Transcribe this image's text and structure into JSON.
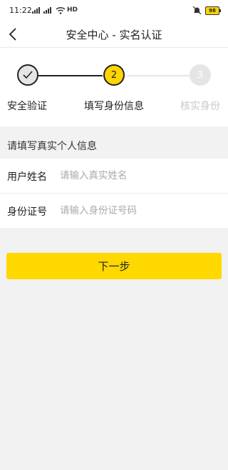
{
  "status_bar": {
    "time": "11:22",
    "network": "HD",
    "battery": "98"
  },
  "header": {
    "title": "安全中心 - 实名认证"
  },
  "steps": [
    {
      "number": "",
      "label": "安全验证",
      "state": "done"
    },
    {
      "number": "2",
      "label": "填写身份信息",
      "state": "active"
    },
    {
      "number": "3",
      "label": "核实身份",
      "state": "pending"
    }
  ],
  "form": {
    "hint": "请填写真实个人信息",
    "name": {
      "label": "用户姓名",
      "value": "",
      "placeholder": "请输入真实姓名"
    },
    "id_number": {
      "label": "身份证号",
      "value": "",
      "placeholder": "请输入身份证号码"
    }
  },
  "next_button": {
    "label": "下一步"
  },
  "colors": {
    "accent": "#ffd800",
    "background": "#f2f2f2",
    "pending": "#c8c8c8"
  }
}
